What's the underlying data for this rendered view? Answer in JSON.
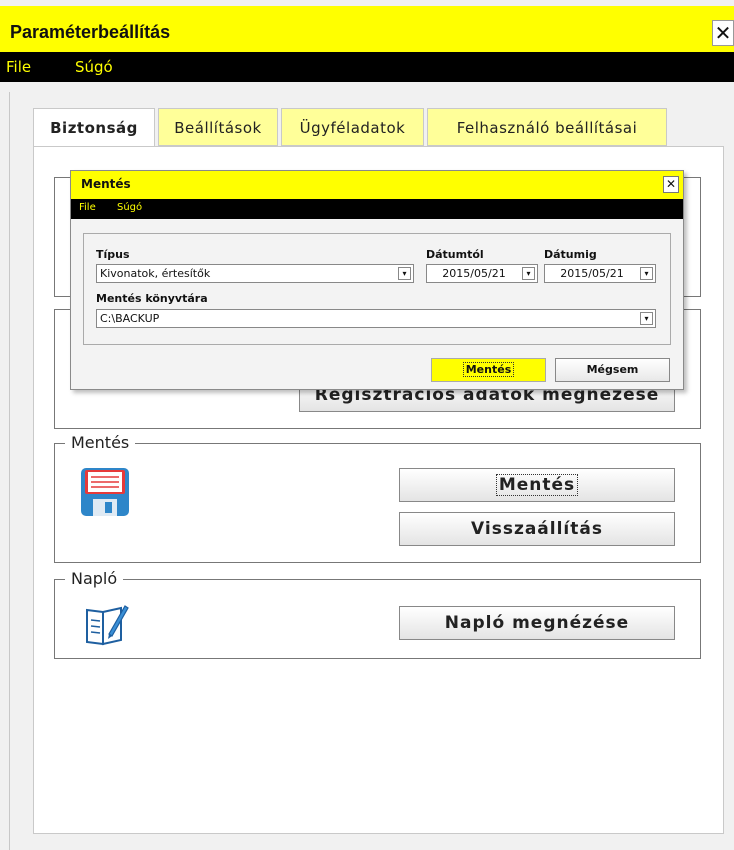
{
  "window": {
    "title": "Paraméterbeállítás",
    "close_glyph": "✕",
    "menu": [
      "File",
      "Súgó"
    ]
  },
  "tabs": [
    {
      "label": "Biztonság",
      "active": true
    },
    {
      "label": "Beállítások",
      "active": false
    },
    {
      "label": "Ügyféladatok",
      "active": false
    },
    {
      "label": "Felhasználó beállításai",
      "active": false
    }
  ],
  "groups": {
    "registration": {
      "button_label": "Regisztrációs adatok megnézése"
    },
    "backup": {
      "legend": "Mentés",
      "icon": "floppy-disk-icon",
      "save_label": "Mentés",
      "restore_label": "Visszaállítás"
    },
    "log": {
      "legend": "Napló",
      "icon": "notebook-pen-icon",
      "view_label": "Napló megnézése"
    }
  },
  "dialog": {
    "title": "Mentés",
    "close_glyph": "✕",
    "menu": [
      "File",
      "Súgó"
    ],
    "type_label": "Típus",
    "type_value": "Kivonatok, értesítők",
    "from_label": "Dátumtól",
    "from_value": "2015/05/21",
    "to_label": "Dátumig",
    "to_value": "2015/05/21",
    "dir_label": "Mentés könyvtára",
    "dir_value": "C:\\BACKUP",
    "save_label": "Mentés",
    "cancel_label": "Mégsem"
  },
  "colors": {
    "accent": "#ffff00",
    "menubar": "#000000",
    "menu_text": "#ffff00"
  }
}
